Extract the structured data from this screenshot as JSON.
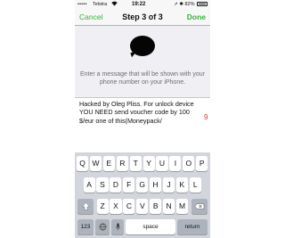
{
  "status": {
    "signal": "•••••",
    "carrier": "Telstra",
    "wifi_icon": "wifi-icon",
    "time": "19:22",
    "right": "82%"
  },
  "nav": {
    "cancel_label": "Cancel",
    "title": "Step 3 of 3",
    "done_label": "Done"
  },
  "header": {
    "icon": "chat-bubble-icon",
    "prompt": "Enter a message that will be shown with your phone number on your iPhone."
  },
  "message": {
    "text": "Hacked by Oleg Pliss. For unlock device YOU NEED send voucher code by 100 $/eur one of this(Moneypack/",
    "char_count": "9"
  },
  "keyboard": {
    "row1": [
      "Q",
      "W",
      "E",
      "R",
      "T",
      "Y",
      "U",
      "I",
      "O",
      "P"
    ],
    "row2": [
      "A",
      "S",
      "D",
      "F",
      "G",
      "H",
      "J",
      "K",
      "L"
    ],
    "row3": [
      "Z",
      "X",
      "C",
      "V",
      "B",
      "N",
      "M"
    ],
    "numbers_label": "123",
    "space_label": "space",
    "return_label": "return",
    "shift_icon": "shift-arrow-icon",
    "delete_icon": "delete-backspace-icon",
    "globe_icon": "globe-icon",
    "mic_icon": "microphone-icon"
  },
  "colors": {
    "accent": "#33b53a",
    "counter": "#d9342b",
    "header_bg": "#efeff4",
    "keyboard_bg": "#d2d5db"
  }
}
